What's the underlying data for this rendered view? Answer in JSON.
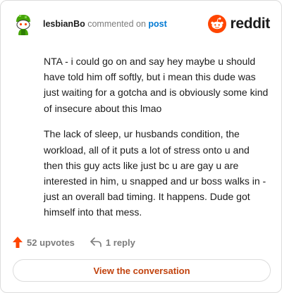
{
  "header": {
    "username": "lesbianBo",
    "commented_text": "commented on",
    "post_link": "post",
    "brand_name": "reddit"
  },
  "icons": {
    "avatar": "snoo-avatar-icon",
    "brand": "reddit-logo-icon",
    "upvote": "upvote-arrow-icon",
    "reply": "reply-arrow-icon"
  },
  "comment": {
    "paragraphs": [
      "NTA - i could go on and say hey maybe u should have told him off softly, but i mean this dude was just waiting for a gotcha and is obviously some kind of insecure about this lmao",
      "The lack of sleep, ur husbands condition, the workload, all of it puts a lot of stress onto u and then this guy acts like just bc u are gay u are interested in him, u snapped and ur boss walks in - just an overall bad timing. It happens. Dude got himself into that mess."
    ]
  },
  "actions": {
    "upvotes": "52 upvotes",
    "replies": "1 reply"
  },
  "cta": {
    "label": "View the conversation"
  },
  "colors": {
    "accent_orange": "#ff4500",
    "link_blue": "#0079d3",
    "cta_text": "#c1420d",
    "avatar_green": "#46a508"
  }
}
